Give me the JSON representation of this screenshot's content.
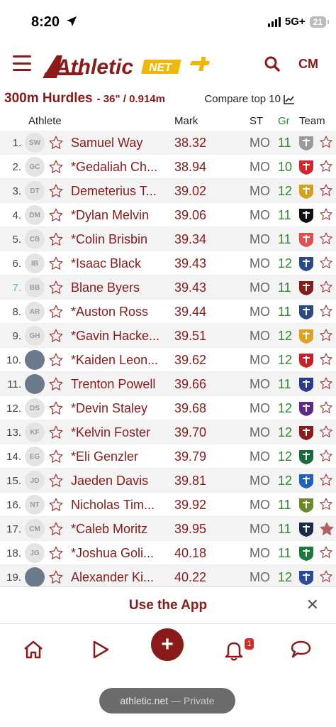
{
  "status_bar": {
    "time": "8:20",
    "network": "5G+",
    "battery": "21"
  },
  "navbar": {
    "logo_word": "Athletic",
    "logo_net": "NET",
    "user_initials": "CM",
    "colors": {
      "brand": "#8b1a1a",
      "gold": "#f2b705"
    }
  },
  "event": {
    "name": "300m Hurdles",
    "spec": "- 36\" / 0.914m",
    "compare_label": "Compare top 10"
  },
  "columns": {
    "athlete": "Athlete",
    "mark": "Mark",
    "state": "ST",
    "grade": "Gr",
    "team": "Team"
  },
  "rows": [
    {
      "rank": "1.",
      "initials": "SW",
      "name": "Samuel Way",
      "mark": "38.32",
      "st": "MO",
      "gr": "11",
      "team_icon": "bulldog-logo"
    },
    {
      "rank": "2.",
      "initials": "GC",
      "name": "*Gedaliah Ch...",
      "mark": "38.94",
      "st": "MO",
      "gr": "10",
      "team_icon": "hawk-logo"
    },
    {
      "rank": "3.",
      "initials": "DT",
      "name": "Demeterius T...",
      "mark": "39.02",
      "st": "MO",
      "gr": "12",
      "team_icon": "eagle-logo"
    },
    {
      "rank": "4.",
      "initials": "DM",
      "name": "*Dylan Melvin",
      "mark": "39.06",
      "st": "MO",
      "gr": "11",
      "team_icon": "panther-logo"
    },
    {
      "rank": "5.",
      "initials": "CB",
      "name": "*Colin Brisbin",
      "mark": "39.34",
      "st": "MO",
      "gr": "11",
      "team_icon": "wing-logo"
    },
    {
      "rank": "6.",
      "initials": "IB",
      "name": "*Isaac Black",
      "mark": "39.43",
      "st": "MO",
      "gr": "12",
      "team_icon": "shield-logo"
    },
    {
      "rank": "7.",
      "initials": "BB",
      "name": "Blane Byers",
      "mark": "39.43",
      "st": "MO",
      "gr": "11",
      "team_icon": "k-logo",
      "tie": true
    },
    {
      "rank": "8.",
      "initials": "AR",
      "name": "*Auston Ross",
      "mark": "39.44",
      "st": "MO",
      "gr": "11",
      "team_icon": "h-logo"
    },
    {
      "rank": "9.",
      "initials": "GH",
      "name": "*Gavin Hacke...",
      "mark": "39.51",
      "st": "MO",
      "gr": "12",
      "team_icon": "cougar-logo"
    },
    {
      "rank": "10.",
      "initials": "",
      "name": "*Kaiden Leon...",
      "mark": "39.62",
      "st": "MO",
      "gr": "12",
      "team_icon": "rh-logo",
      "photo": true
    },
    {
      "rank": "11.",
      "initials": "",
      "name": "Trenton Powell",
      "mark": "39.66",
      "st": "MO",
      "gr": "11",
      "team_icon": "nh-logo",
      "photo": true
    },
    {
      "rank": "12.",
      "initials": "DS",
      "name": "*Devin Staley",
      "mark": "39.68",
      "st": "MO",
      "gr": "12",
      "team_icon": "purple-logo"
    },
    {
      "rank": "13.",
      "initials": "KF",
      "name": "*Kelvin Foster",
      "mark": "39.70",
      "st": "MO",
      "gr": "12",
      "team_icon": "t-logo"
    },
    {
      "rank": "14.",
      "initials": "EG",
      "name": "*Eli Genzler",
      "mark": "39.79",
      "st": "MO",
      "gr": "12",
      "team_icon": "gator-logo"
    },
    {
      "rank": "15.",
      "initials": "JD",
      "name": "Jaeden Davis",
      "mark": "39.81",
      "st": "MO",
      "gr": "12",
      "team_icon": "jay-logo"
    },
    {
      "rank": "16.",
      "initials": "NT",
      "name": "Nicholas Tim...",
      "mark": "39.92",
      "st": "MO",
      "gr": "11",
      "team_icon": "bull-logo"
    },
    {
      "rank": "17.",
      "initials": "CM",
      "name": "*Caleb Moritz",
      "mark": "39.95",
      "st": "MO",
      "gr": "11",
      "team_icon": "dark-logo",
      "favorited": true
    },
    {
      "rank": "18.",
      "initials": "JG",
      "name": "*Joshua Goli...",
      "mark": "40.18",
      "st": "MO",
      "gr": "11",
      "team_icon": "green-logo"
    },
    {
      "rank": "19.",
      "initials": "",
      "name": "Alexander Ki...",
      "mark": "40.22",
      "st": "MO",
      "gr": "12",
      "team_icon": "blue-circle-logo",
      "photo": true
    }
  ],
  "banner": {
    "label": "Use the App"
  },
  "tabbar": {
    "notifications_count": "1"
  },
  "browser": {
    "domain": "athletic.net",
    "mode": "— Private"
  }
}
